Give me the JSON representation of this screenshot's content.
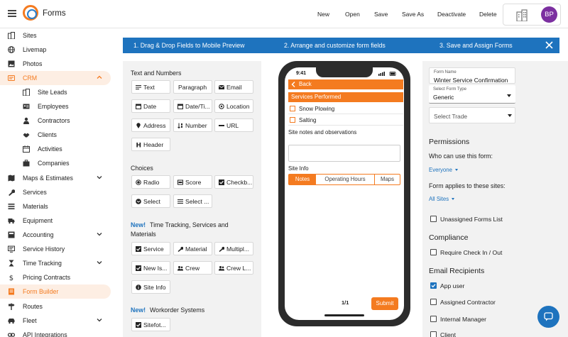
{
  "app": {
    "title": "Forms"
  },
  "toolbar": {
    "new_label": "New",
    "open_label": "Open",
    "save_label": "Save",
    "save_as_label": "Save As",
    "deactivate_label": "Deactivate",
    "delete_label": "Delete"
  },
  "user": {
    "initials": "BP",
    "avatar_color": "#7b2fa0"
  },
  "colors": {
    "accent": "#f47b20",
    "primary": "#1e73be"
  },
  "sidebar": {
    "items": [
      {
        "label": "Sites",
        "icon": "building-icon"
      },
      {
        "label": "Livemap",
        "icon": "globe-icon"
      },
      {
        "label": "Photos",
        "icon": "photo-icon"
      },
      {
        "label": "CRM",
        "icon": "crm-icon",
        "active": true,
        "expanded": true
      },
      {
        "label": "Site Leads",
        "icon": "building-icon",
        "sub": true
      },
      {
        "label": "Employees",
        "icon": "id-card-icon",
        "sub": true
      },
      {
        "label": "Contractors",
        "icon": "person-icon",
        "sub": true
      },
      {
        "label": "Clients",
        "icon": "handshake-icon",
        "sub": true
      },
      {
        "label": "Activities",
        "icon": "calendar-icon",
        "sub": true
      },
      {
        "label": "Companies",
        "icon": "briefcase-icon",
        "sub": true
      },
      {
        "label": "Maps & Estimates",
        "icon": "map-icon",
        "has_chevron": true
      },
      {
        "label": "Services",
        "icon": "wrench-icon"
      },
      {
        "label": "Materials",
        "icon": "materials-icon"
      },
      {
        "label": "Equipment",
        "icon": "truck-icon"
      },
      {
        "label": "Accounting",
        "icon": "ledger-icon",
        "has_chevron": true
      },
      {
        "label": "Service History",
        "icon": "history-icon"
      },
      {
        "label": "Time Tracking",
        "icon": "hourglass-icon",
        "has_chevron": true
      },
      {
        "label": "Pricing Contracts",
        "icon": "dollar-icon"
      },
      {
        "label": "Form Builder",
        "icon": "form-icon",
        "selected": true
      },
      {
        "label": "Routes",
        "icon": "signpost-icon"
      },
      {
        "label": "Fleet",
        "icon": "car-icon",
        "has_chevron": true
      },
      {
        "label": "API Integrations",
        "icon": "link-icon"
      }
    ]
  },
  "steps": {
    "step1": "1. Drag & Drop Fields to Mobile Preview",
    "step2": "2. Arrange and customize form fields",
    "step3": "3. Save and Assign Forms"
  },
  "palette": {
    "text_numbers_heading": "Text and Numbers",
    "text_numbers": [
      {
        "label": "Text",
        "icon": "text-lines-icon"
      },
      {
        "label": "Paragraph",
        "icon": "paragraph-icon"
      },
      {
        "label": "Email",
        "icon": "email-icon"
      },
      {
        "label": "Date",
        "icon": "calendar-icon"
      },
      {
        "label": "Date/Ti...",
        "icon": "calendar-clock-icon"
      },
      {
        "label": "Location",
        "icon": "location-icon"
      },
      {
        "label": "Address",
        "icon": "map-pin-icon"
      },
      {
        "label": "Number",
        "icon": "number-sort-icon"
      },
      {
        "label": "URL",
        "icon": "url-icon"
      },
      {
        "label": "Header",
        "icon": "header-icon"
      }
    ],
    "choices_heading": "Choices",
    "choices": [
      {
        "label": "Radio",
        "icon": "radio-icon"
      },
      {
        "label": "Score",
        "icon": "score-icon"
      },
      {
        "label": "Checkb...",
        "icon": "checkbox-icon"
      },
      {
        "label": "Select",
        "icon": "select-icon"
      },
      {
        "label": "Select ...",
        "icon": "select-multi-icon"
      }
    ],
    "new_badge": "New!",
    "time_heading": "Time Tracking, Services and Materials",
    "time": [
      {
        "label": "Service",
        "icon": "checkbox-icon"
      },
      {
        "label": "Material",
        "icon": "wrench-icon"
      },
      {
        "label": "Multipl...",
        "icon": "wrench-icon"
      },
      {
        "label": "New Is...",
        "icon": "checkbox-icon"
      },
      {
        "label": "Crew",
        "icon": "crew-icon"
      },
      {
        "label": "Crew L...",
        "icon": "crew-icon"
      },
      {
        "label": "Site Info",
        "icon": "info-icon"
      }
    ],
    "workorder_heading": "Workorder Systems",
    "workorder": [
      {
        "label": "Sitefot...",
        "icon": "checkbox-icon"
      }
    ]
  },
  "phone": {
    "time": "9:41",
    "back_label": "Back",
    "section_title": "Services Performed",
    "options": [
      "Snow Plowing",
      "Salting"
    ],
    "notes_label": "Site notes and observations",
    "site_info_label": "Site Info",
    "tabs": [
      "Notes",
      "Operating Hours",
      "Maps"
    ],
    "active_tab": "Notes",
    "pager": "1/1",
    "submit_label": "Submit"
  },
  "settings": {
    "form_name_label": "Form Name",
    "form_name_value": "Winter Service Confirmation",
    "form_type_label": "Select Form Type",
    "form_type_value": "Generic",
    "trade_placeholder": "Select Trade",
    "permissions_heading": "Permissions",
    "who_can_use": "Who can use this form:",
    "who_can_use_value": "Everyone",
    "applies_to": "Form applies to these sites:",
    "applies_to_value": "All Sites",
    "unassigned_label": "Unassigned Forms List",
    "compliance_heading": "Compliance",
    "require_check_label": "Require Check In / Out",
    "email_heading": "Email Recipients",
    "recipients": [
      {
        "label": "App user",
        "checked": true
      },
      {
        "label": "Assigned Contractor",
        "checked": false
      },
      {
        "label": "Internal Manager",
        "checked": false
      },
      {
        "label": "Client",
        "checked": false
      }
    ]
  }
}
